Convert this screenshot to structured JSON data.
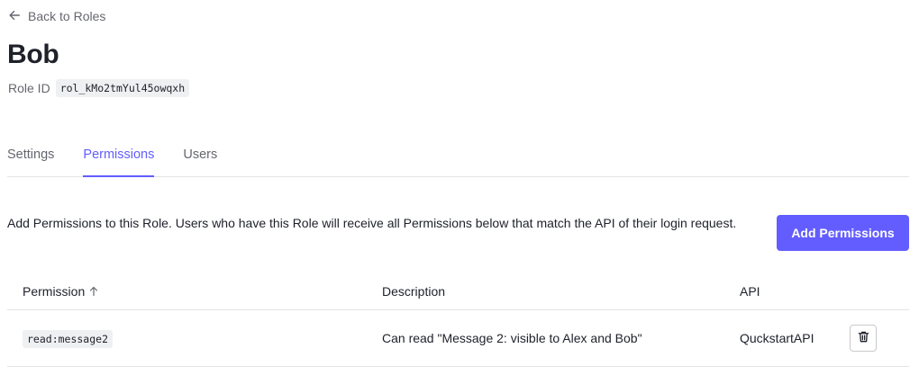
{
  "header": {
    "back_label": "Back to Roles",
    "title": "Bob",
    "role_id_label": "Role ID",
    "role_id_value": "rol_kMo2tmYul45owqxh"
  },
  "tabs": [
    {
      "label": "Settings",
      "active": false
    },
    {
      "label": "Permissions",
      "active": true
    },
    {
      "label": "Users",
      "active": false
    }
  ],
  "permissions_section": {
    "description": "Add Permissions to this Role. Users who have this Role will receive all Permissions below that match the API of their login request.",
    "add_button_label": "Add Permissions",
    "columns": [
      "Permission",
      "Description",
      "API"
    ],
    "sort_column": "Permission",
    "sort_direction": "ascending",
    "rows": [
      {
        "permission": "read:message2",
        "description": "Can read \"Message 2: visible to Alex and Bob\"",
        "api": "QuckstartAPI",
        "action_icon": "trash-icon"
      }
    ]
  },
  "colors": {
    "accent": "#635dff",
    "text": "#1e212a",
    "muted": "#65676e",
    "border": "#e3e4e8",
    "code_bg": "#eff0f2"
  }
}
